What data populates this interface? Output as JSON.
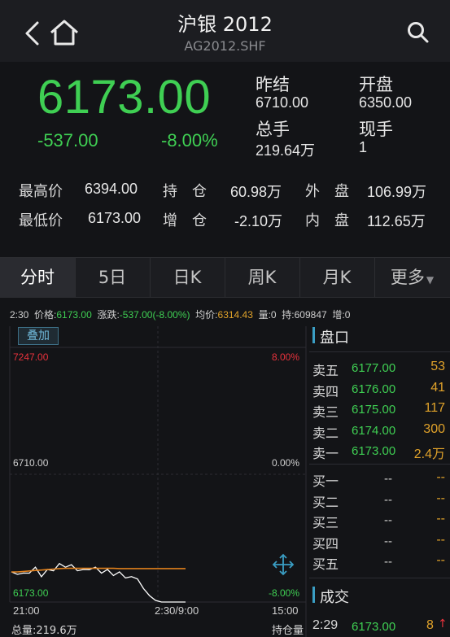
{
  "header": {
    "title": "沪银 2012",
    "code": "AG2012.SHF"
  },
  "quote": {
    "price": "6173.00",
    "change": "-537.00",
    "change_pct": "-8.00%",
    "prev_settle_label": "昨结",
    "prev_settle": "6710.00",
    "open_label": "开盘",
    "open": "6350.00",
    "total_vol_label": "总手",
    "total_vol": "219.64万",
    "cur_vol_label": "现手",
    "cur_vol": "1"
  },
  "stats": {
    "high_label": "最高价",
    "high": "6394.00",
    "low_label": "最低价",
    "low": "6173.00",
    "oi_label": "持　仓",
    "oi": "60.98万",
    "oi_chg_label": "增　仓",
    "oi_chg": "-2.10万",
    "outer_label": "外　盘",
    "outer": "106.99万",
    "inner_label": "内　盘",
    "inner": "112.65万"
  },
  "tabs": [
    "分时",
    "5日",
    "日K",
    "周K",
    "月K",
    "更多"
  ],
  "info_bar": {
    "time": "2:30",
    "price_label": "价格:",
    "price": "6173.00",
    "change_label": "涨跌:",
    "change": "-537.00(-8.00%)",
    "avg_label": "均价:",
    "avg": "6314.43",
    "vol_label": "量:",
    "vol": "0",
    "oi_label": "持:",
    "oi": "609847",
    "inc_label": "增:",
    "inc": "0"
  },
  "chart": {
    "overlay_label": "叠加",
    "y_top": "7247.00",
    "y_mid": "6710.00",
    "y_bot": "6173.00",
    "pct_top": "8.00%",
    "pct_mid": "0.00%",
    "pct_bot": "-8.00%",
    "x_start": "21:00",
    "x_mid": "2:30/9:00",
    "x_end": "15:00",
    "colors": {
      "price_line": "#ffffff",
      "avg_line": "#e0801c",
      "up": "#e8323c",
      "down": "#3fcf53"
    }
  },
  "chart_data": {
    "type": "line",
    "x_labels": [
      "21:00",
      "2:30/9:00",
      "15:00"
    ],
    "ylim": [
      6173,
      7247
    ],
    "series": [
      {
        "name": "价格",
        "values": [
          6290,
          6300,
          6285,
          6305,
          6310,
          6290,
          6300,
          6315,
          6325,
          6330,
          6320,
          6315,
          6300,
          6320,
          6310,
          6305,
          6300,
          6295,
          6290,
          6285,
          6280,
          6270,
          6230,
          6200,
          6180,
          6173,
          6173,
          6173,
          6173,
          6173
        ]
      },
      {
        "name": "均价",
        "values": [
          6300,
          6300,
          6302,
          6304,
          6306,
          6308,
          6310,
          6312,
          6314,
          6315,
          6315,
          6315,
          6315,
          6315,
          6315,
          6315,
          6315,
          6315,
          6314,
          6314,
          6314,
          6314,
          6314,
          6314,
          6314,
          6314,
          6314,
          6314,
          6314,
          6314
        ]
      }
    ]
  },
  "order_book": {
    "title": "盘口",
    "asks": [
      {
        "label": "卖五",
        "price": "6177.00",
        "vol": "53"
      },
      {
        "label": "卖四",
        "price": "6176.00",
        "vol": "41"
      },
      {
        "label": "卖三",
        "price": "6175.00",
        "vol": "117"
      },
      {
        "label": "卖二",
        "price": "6174.00",
        "vol": "300"
      },
      {
        "label": "卖一",
        "price": "6173.00",
        "vol": "2.4万"
      }
    ],
    "bids": [
      {
        "label": "买一",
        "price": "--",
        "vol": "--"
      },
      {
        "label": "买二",
        "price": "--",
        "vol": "--"
      },
      {
        "label": "买三",
        "price": "--",
        "vol": "--"
      },
      {
        "label": "买四",
        "price": "--",
        "vol": "--"
      },
      {
        "label": "买五",
        "price": "--",
        "vol": "--"
      }
    ]
  },
  "trades": {
    "title": "成交",
    "rows": [
      {
        "time": "2:29",
        "price": "6173.00",
        "vol": "8",
        "dir": "↑"
      }
    ]
  },
  "footer": {
    "total_vol": "总量:219.6万",
    "oi": "持仓量"
  }
}
